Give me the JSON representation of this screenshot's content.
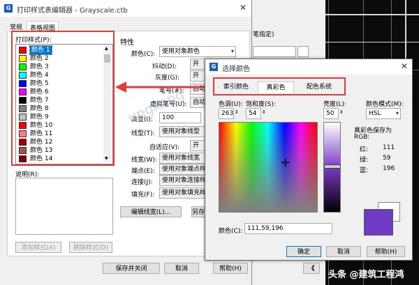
{
  "main_dialog": {
    "title": "打印样式表编辑器 - Grayscale.ctb",
    "tabs": [
      "常规",
      "表格视图"
    ],
    "list_label": "打印样式(P):",
    "list_items": [
      {
        "label": "颜色 1",
        "color": "#ff0000",
        "selected": true
      },
      {
        "label": "颜色 2",
        "color": "#ffff00"
      },
      {
        "label": "颜色 3",
        "color": "#00ff00"
      },
      {
        "label": "颜色 4",
        "color": "#00ffff"
      },
      {
        "label": "颜色 5",
        "color": "#0000ff"
      },
      {
        "label": "颜色 6",
        "color": "#ff00ff"
      },
      {
        "label": "颜色 7",
        "color": "#000000"
      },
      {
        "label": "颜色 8",
        "color": "#808080"
      },
      {
        "label": "颜色 9",
        "color": "#c0c0c0"
      },
      {
        "label": "颜色 10",
        "color": "#ff0000"
      },
      {
        "label": "颜色 11",
        "color": "#ff7f7f"
      },
      {
        "label": "颜色 12",
        "color": "#a50000"
      },
      {
        "label": "颜色 13",
        "color": "#a55252"
      },
      {
        "label": "颜色 14",
        "color": "#7f0000"
      }
    ],
    "description_label": "说明(R):",
    "add_style": "添加样式(A)",
    "delete_style": "删除样式(D)",
    "save_close": "保存并关闭",
    "cancel": "取消",
    "help": "帮助(H)",
    "properties": {
      "heading": "特性",
      "color_label": "颜色(C):",
      "color_value": "使用对象颜色",
      "dither_label": "抖动(D):",
      "dither_value": "开",
      "grayscale_label": "灰度(G):",
      "grayscale_value": "开",
      "pen_label": "笔号(#):",
      "pen_value": "自动",
      "virtual_pen_label": "虚拟笔号(U):",
      "virtual_pen_value": "自动",
      "screening_label": "淡显(I):",
      "screening_value": "100",
      "linetype_label": "线型(T):",
      "linetype_value": "使用对象线型",
      "adaptive_label": "自适应(V):",
      "adaptive_value": "开",
      "lineweight_label": "线宽(W):",
      "lineweight_value": "使用对象线宽",
      "endstyle_label": "端点(E):",
      "endstyle_value": "使用对象端点样",
      "joinstyle_label": "连接(J):",
      "joinstyle_value": "使用对象连接样",
      "fill_label": "填充(F):",
      "fill_value": "使用对象填充样",
      "edit_lineweights": "编辑线宽(L)...",
      "save_as": "另存"
    }
  },
  "color_dialog": {
    "title": "选择颜色",
    "tabs": [
      "索引颜色",
      "真彩色",
      "配色系统"
    ],
    "active_tab": "真彩色",
    "hue_label": "色调(U):",
    "hue_value": "263",
    "saturation_label": "饱和度(S):",
    "saturation_value": "54",
    "luminance_label": "亮度(L):",
    "luminance_value": "50",
    "color_model_label": "颜色模式(M):",
    "color_model_value": "HSL",
    "truecolor_saved_label": "真彩色保存为",
    "truecolor_saved_sub": "RGB:",
    "red_label": "红:",
    "red_value": "111",
    "green_label": "绿:",
    "green_value": "59",
    "blue_label": "蓝:",
    "blue_value": "196",
    "color_label": "颜色(C):",
    "color_value": "111,59,196",
    "ok": "确定",
    "cancel": "取消",
    "help": "帮助(H)",
    "selected_color": "#6f3bc4"
  },
  "background_dialog": {
    "spec_text": "笔指定)",
    "expand_button": "《"
  },
  "watermark": "ungkong",
  "brand": "头条 @建筑工程鸿"
}
